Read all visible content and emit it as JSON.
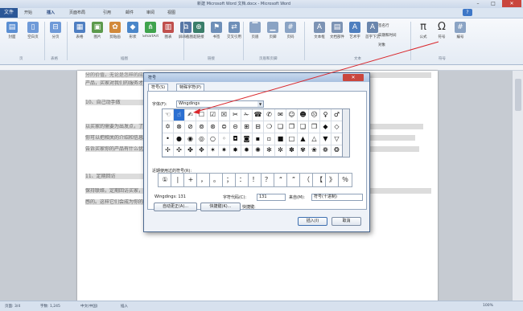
{
  "window": {
    "title": "新建 Microsoft Word 文档.docx - Microsoft Word",
    "minimize_glyph": "–",
    "maximize_glyph": "□",
    "close_glyph": "✕"
  },
  "menu": {
    "file": "文件",
    "tabs": [
      "开始",
      "插入",
      "页面布局",
      "引用",
      "邮件",
      "审阅",
      "视图"
    ],
    "help_glyph": "?"
  },
  "ribbon": {
    "buttons": [
      {
        "label": "封面",
        "icon": "cover-page-icon",
        "glyph": "▤",
        "color": "#5b8fd3"
      },
      {
        "label": "空白页",
        "icon": "blank-page-icon",
        "glyph": "▯",
        "color": "#6f9ad8"
      },
      {
        "label": "分页",
        "icon": "page-break-icon",
        "glyph": "⊟",
        "color": "#6f9ad8"
      },
      {
        "label": "表格",
        "icon": "table-icon",
        "glyph": "▦",
        "color": "#4f7fc2"
      },
      {
        "label": "图片",
        "icon": "picture-icon",
        "glyph": "▣",
        "color": "#5c9a4c"
      },
      {
        "label": "剪贴画",
        "icon": "clipart-icon",
        "glyph": "✿",
        "color": "#d1893a"
      },
      {
        "label": "形状",
        "icon": "shapes-icon",
        "glyph": "◆",
        "color": "#4a86c9"
      },
      {
        "label": "SmartArt",
        "icon": "smartart-icon",
        "glyph": "⋔",
        "color": "#3fa34d"
      },
      {
        "label": "图表",
        "icon": "chart-icon",
        "glyph": "▥",
        "color": "#c0504d"
      },
      {
        "label": "屏幕截图",
        "icon": "screenshot-icon",
        "glyph": "⧉",
        "color": "#5777a5"
      },
      {
        "label": "超链接",
        "icon": "hyperlink-icon",
        "glyph": "⊕",
        "color": "#3a7e6a"
      },
      {
        "label": "书签",
        "icon": "bookmark-icon",
        "glyph": "⚑",
        "color": "#6e8fb8"
      },
      {
        "label": "交叉引用",
        "icon": "cross-reference-icon",
        "glyph": "⇄",
        "color": "#6e8fb8"
      },
      {
        "label": "页眉",
        "icon": "header-icon",
        "glyph": "▔",
        "color": "#8aa3c4"
      },
      {
        "label": "页脚",
        "icon": "footer-icon",
        "glyph": "▁",
        "color": "#8aa3c4"
      },
      {
        "label": "页码",
        "icon": "page-number-icon",
        "glyph": "#",
        "color": "#8aa3c4"
      },
      {
        "label": "文本框",
        "icon": "textbox-icon",
        "glyph": "A",
        "color": "#7c93b4"
      },
      {
        "label": "文档部件",
        "icon": "quick-parts-icon",
        "glyph": "▤",
        "color": "#7c93b4"
      },
      {
        "label": "艺术字",
        "icon": "wordart-icon",
        "glyph": "A",
        "color": "#4e7fbf"
      },
      {
        "label": "首字下沉",
        "icon": "drop-cap-icon",
        "glyph": "A",
        "color": "#6a86ad"
      }
    ],
    "text_group_small": [
      "签名行",
      "日期和时间",
      "对象"
    ],
    "equation": {
      "label": "公式",
      "glyph": "π"
    },
    "symbol": {
      "label": "符号",
      "glyph": "Ω"
    },
    "number": {
      "label": "编号",
      "glyph": "#"
    },
    "groups": [
      "页",
      "表格",
      "插图",
      "链接",
      "页眉和页脚",
      "文本",
      "符号"
    ]
  },
  "document": {
    "lines": [
      "分的价值，无论是怎样的应用领域，让产品在人们心中留下深刻的印象,从而提升",
      "产品，买家对我们的服务才能够有满意的认可。",
      "10、自己动手做",
      "",
      "以买家的需要为出发点，了解买家需要什么样的产品和服务，从而更好地解答。这样",
      "你可以把相关的介绍和信息提供给买家，让买家更加了解我们的产品，最好先",
      "告诉买家你的产品有什么优点，以此来获得买家的信任，让交易变得更加容易达成。",
      "",
      "11、定期回访",
      "    保持联络，定期回访买家，了解买家对产品的意见，不断改进服务，增加回头买家的",
      "感的。这样它们会成为你的忠实客户。"
    ]
  },
  "status": {
    "page": "页面: 3/4",
    "words": "字数: 1,245",
    "language": "中文(中国)",
    "mode": "插入",
    "zoom": "100%"
  },
  "dialog": {
    "title": "符号",
    "close_glyph": "✕",
    "tabs": [
      "符号(S)",
      "特殊字符(P)"
    ],
    "font_label": "字体(F):",
    "font_value": "Wingdings",
    "grid_rows": [
      [
        "☜",
        "☝",
        "✍",
        "☐",
        "☑",
        "☒",
        "✂",
        "✁",
        "☎",
        "✆",
        "✉",
        "☺",
        "☻",
        "☹",
        "♀",
        "♂",
        "♁",
        "♃",
        "♄",
        "♅",
        "♆",
        "♇",
        "♈",
        "♉",
        "♊",
        "♋",
        "♌",
        "♍",
        "♎",
        "♏",
        "♐",
        "♑"
      ],
      [
        "✡",
        "⊗",
        "⊘",
        "⊚",
        "⊛",
        "⊜",
        "⊝",
        "⊞",
        "⊟",
        "❍",
        "❏",
        "❐",
        "❑",
        "❒",
        "◆",
        "◇",
        "❖",
        "⬥",
        "⬦",
        "⬧",
        "⬨",
        "⬩",
        "⬪",
        "⬫",
        "⬬",
        "⬭",
        "⬮",
        "⬯",
        "⬰",
        "⬱",
        "⬲",
        "⬳"
      ],
      [
        "•",
        "●",
        "◉",
        "◎",
        "○",
        "◦",
        "◘",
        "◙",
        "▪",
        "▫",
        "■",
        "□",
        "▲",
        "△",
        "▼",
        "▽",
        "◀",
        "▶",
        "★",
        "☆",
        "✦",
        "✧",
        "✪",
        "✫",
        "✬",
        "✭",
        "✮",
        "✯",
        "✰",
        "✱",
        "✲",
        "✳"
      ],
      [
        "✢",
        "✣",
        "✤",
        "✥",
        "✶",
        "✷",
        "✸",
        "✹",
        "✺",
        "✻",
        "✼",
        "✽",
        "✾",
        "❀",
        "❁",
        "❂",
        "❃",
        "❄",
        "❅",
        "❆",
        "❇",
        "❈",
        "❉",
        "❊",
        "❋",
        "❦",
        "❧",
        "❡",
        "❢",
        "❣",
        "❤",
        "❥"
      ]
    ],
    "recent_label": "近期使用过的符号(R):",
    "recent": [
      "①",
      "∣",
      "+",
      "，",
      "。",
      "；",
      "：",
      "！",
      "？",
      "“",
      "”",
      "（",
      "【",
      "》",
      "％"
    ],
    "char_name": "Wingdings: 131",
    "char_code_label": "字符代码(C):",
    "char_code": "131",
    "from_label": "来自(M):",
    "from_value": "符号(十进制)",
    "autocorrect_button": "自动更正(A)...",
    "shortcut_button": "快捷键(K)...",
    "shortcut_label": "快捷键:",
    "insert_button": "插入(I)",
    "cancel_button": "取消"
  },
  "colors": {
    "accent": "#2b5797",
    "selected_cell": "#2b6fd1",
    "close_button": "#c9463d",
    "annotation_arrow": "#d9262b"
  }
}
